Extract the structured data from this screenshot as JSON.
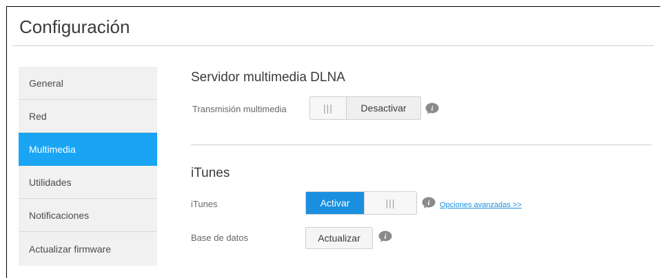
{
  "page": {
    "title": "Configuración"
  },
  "sidebar": {
    "items": [
      {
        "label": "General"
      },
      {
        "label": "Red"
      },
      {
        "label": "Multimedia"
      },
      {
        "label": "Utilidades"
      },
      {
        "label": "Notificaciones"
      },
      {
        "label": "Actualizar firmware"
      }
    ],
    "active_index": 2
  },
  "dlna": {
    "title": "Servidor multimedia DLNA",
    "streaming_label": "Transmisión multimedia",
    "toggle": {
      "grip": "|||",
      "state_label": "Desactivar"
    }
  },
  "itunes": {
    "title": "iTunes",
    "itunes_label": "iTunes",
    "toggle": {
      "state_label": "Activar",
      "grip": "|||"
    },
    "advanced_link": "Opciones avanzadas >>",
    "database_label": "Base de datos",
    "update_button": "Actualizar"
  },
  "colors": {
    "accent": "#1aa4f4",
    "toggle_on": "#1a8fe0",
    "info_icon": "#8a8a8a"
  },
  "icons": {
    "info": "info-icon"
  }
}
